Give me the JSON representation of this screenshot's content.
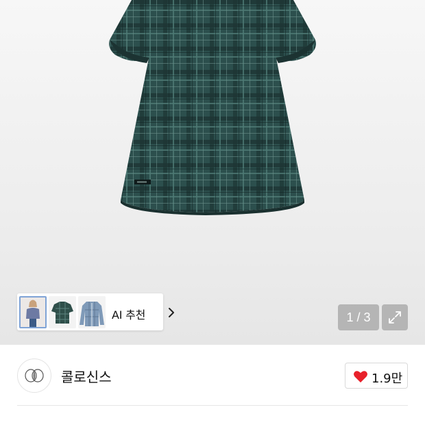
{
  "gallery": {
    "ai_label": "AI 추천",
    "counter": "1 / 3",
    "thumbnails": [
      "thumb-model-plaid",
      "thumb-plaid-shirt",
      "thumb-denim-shirt"
    ]
  },
  "brand": {
    "name": "콜로신스",
    "likes": "1.9만"
  },
  "colors": {
    "plaid_base": "#2c4f4d",
    "heart": "#e8212b"
  },
  "icons": [
    "chevron-right-icon",
    "expand-icon",
    "heart-icon",
    "brand-logo-icon"
  ]
}
